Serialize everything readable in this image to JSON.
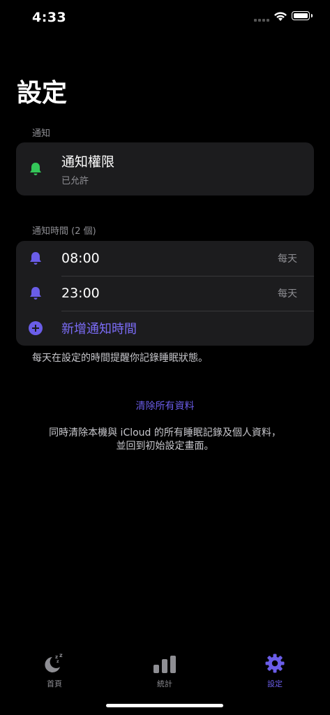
{
  "status_bar": {
    "time": "4:33"
  },
  "page": {
    "title": "設定"
  },
  "notification_section": {
    "header": "通知",
    "permission": {
      "icon": "bell-icon",
      "title": "通知權限",
      "subtitle": "已允許",
      "icon_color": "#34c759"
    }
  },
  "times_section": {
    "header": "通知時間 (2 個)",
    "items": [
      {
        "icon": "bell-icon",
        "time": "08:00",
        "repeat": "每天"
      },
      {
        "icon": "bell-icon",
        "time": "23:00",
        "repeat": "每天"
      }
    ],
    "add_label": "新增通知時間",
    "footer": "每天在設定的時間提醒你記錄睡眠狀態。",
    "icon_color": "#6a5de8"
  },
  "data_section": {
    "clear_label": "清除所有資料",
    "description_line1": "同時清除本機與 iCloud 的所有睡眠記錄及個人資料，",
    "description_line2": "並回到初始設定畫面。"
  },
  "tab_bar": {
    "items": [
      {
        "label": "首頁",
        "icon": "moon-sleep-icon",
        "active": false
      },
      {
        "label": "統計",
        "icon": "bar-chart-icon",
        "active": false
      },
      {
        "label": "設定",
        "icon": "gear-icon",
        "active": true
      }
    ],
    "active_color": "#6a5de8",
    "inactive_color": "#8e8e93"
  }
}
